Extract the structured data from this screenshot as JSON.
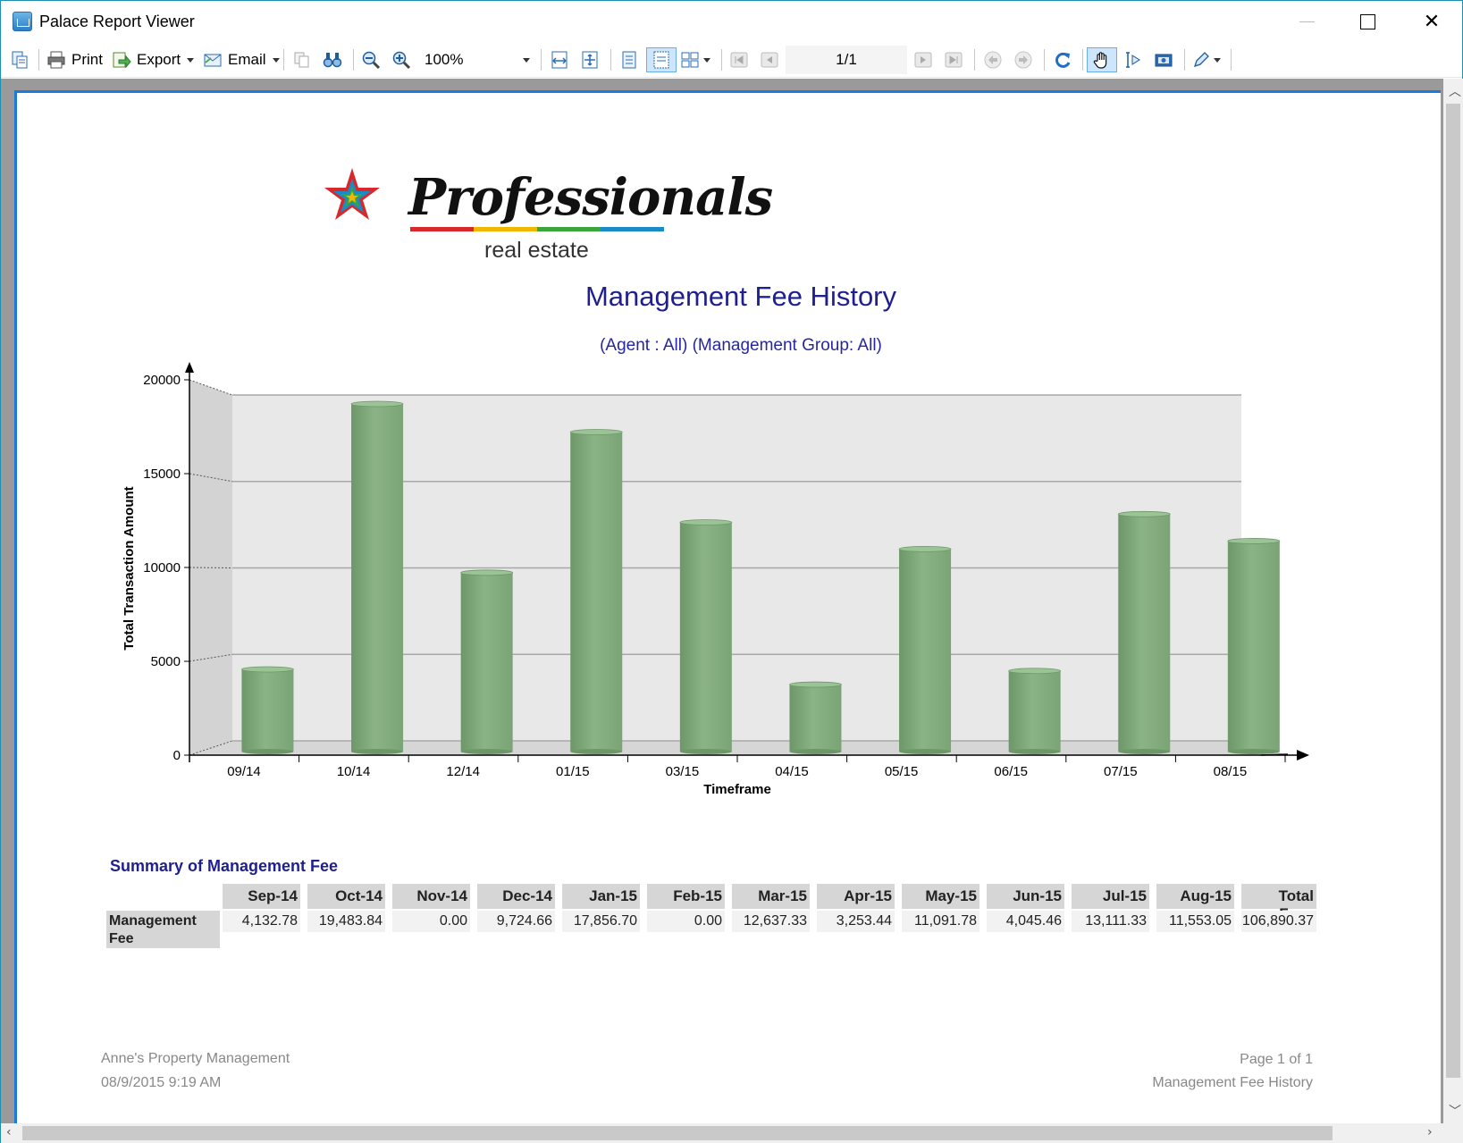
{
  "window": {
    "title": "Palace Report Viewer"
  },
  "toolbar": {
    "print_label": "Print",
    "export_label": "Export",
    "email_label": "Email",
    "zoom_value": "100%",
    "page_indicator": "1/1"
  },
  "report": {
    "logo_word": "Professionals",
    "logo_sub": "real estate",
    "logo_colors": [
      "#d8282b",
      "#f0b800",
      "#3aa53c",
      "#1a8bc4"
    ],
    "title": "Management Fee History",
    "subtitle": "(Agent : All) (Management Group: All)",
    "summary_title": "Summary of Management Fee",
    "summary": {
      "row_label": "Management Fee",
      "headers": [
        "Sep-14",
        "Oct-14",
        "Nov-14",
        "Dec-14",
        "Jan-15",
        "Feb-15",
        "Mar-15",
        "Apr-15",
        "May-15",
        "Jun-15",
        "Jul-15",
        "Aug-15",
        "Total Fees"
      ],
      "values": [
        "4,132.78",
        "19,483.84",
        "0.00",
        "9,724.66",
        "17,856.70",
        "0.00",
        "12,637.33",
        "3,253.44",
        "11,091.78",
        "4,045.46",
        "13,111.33",
        "11,553.05",
        "106,890.37"
      ]
    },
    "footer": {
      "company": "Anne's Property Management",
      "datetime": "08/9/2015 9:19 AM",
      "page": "Page 1 of 1",
      "report_name": "Management Fee History"
    }
  },
  "chart_data": {
    "type": "bar",
    "categories": [
      "09/14",
      "10/14",
      "12/14",
      "01/15",
      "03/15",
      "04/15",
      "05/15",
      "06/15",
      "07/15",
      "08/15"
    ],
    "values": [
      4132.78,
      19483.84,
      9724.66,
      17856.7,
      12637.33,
      3253.44,
      11091.78,
      4045.46,
      13111.33,
      11553.05
    ],
    "xlabel": "Timeframe",
    "ylabel": "Total Transaction Amount",
    "yticks": [
      0,
      5000,
      10000,
      15000,
      20000
    ],
    "ylim": [
      0,
      20000
    ],
    "bar_color": "#8ab386",
    "grid": true
  }
}
